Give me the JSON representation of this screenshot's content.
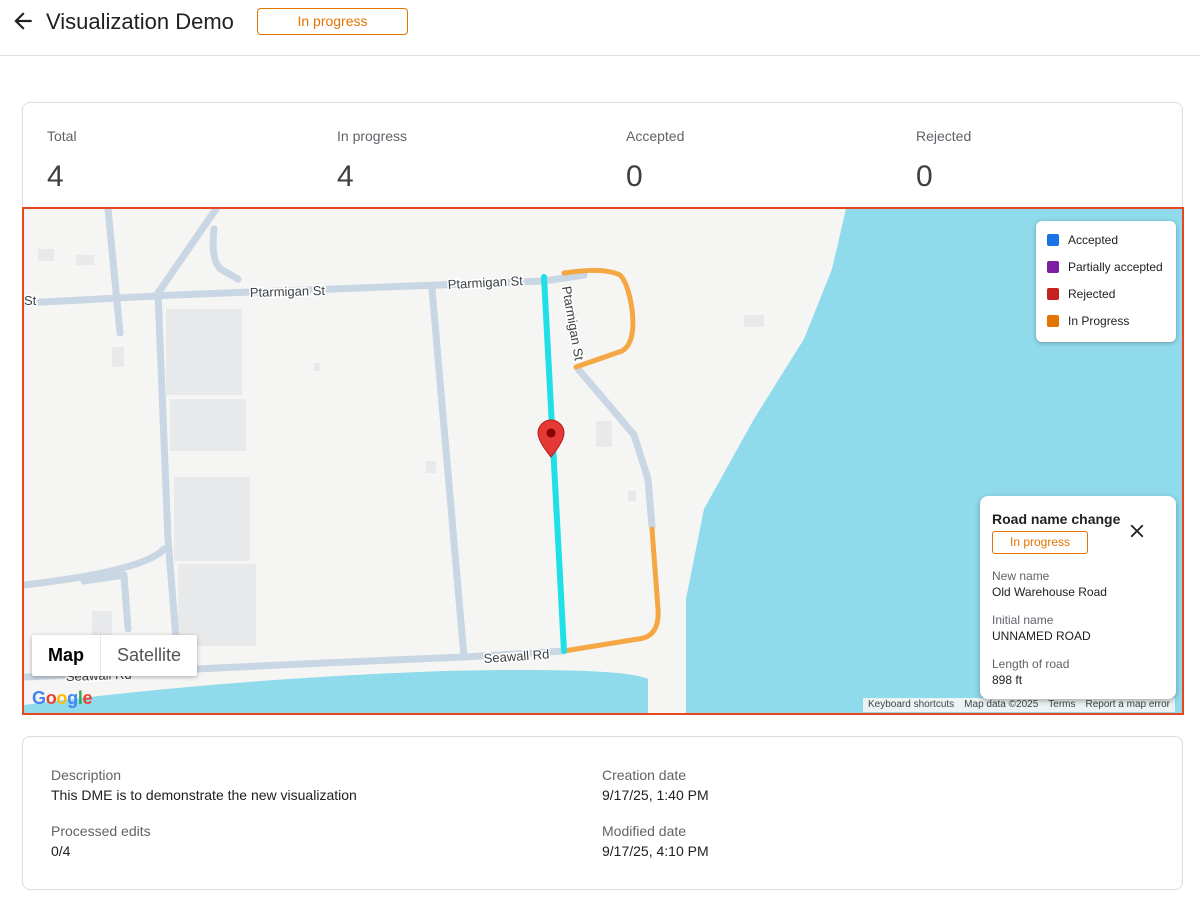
{
  "header": {
    "title": "Visualization Demo",
    "status": "In progress",
    "back_icon": "arrow-left-icon"
  },
  "stats": [
    {
      "label": "Total",
      "value": "4"
    },
    {
      "label": "In progress",
      "value": "4"
    },
    {
      "label": "Accepted",
      "value": "0"
    },
    {
      "label": "Rejected",
      "value": "0"
    }
  ],
  "map": {
    "streets": {
      "ptarmigan_main": "Ptarmigan St",
      "ptarmigan_east": "Ptarmigan St",
      "ptarmigan_vertical": "Ptarmigan St",
      "ptarmigan_left_edge": "St",
      "seawall": "Seawall Rd",
      "seawall_west": "Seawall Rd"
    },
    "legend": [
      {
        "label": "Accepted",
        "color": "#1a73e8"
      },
      {
        "label": "Partially accepted",
        "color": "#7b1fa2"
      },
      {
        "label": "Rejected",
        "color": "#c5221f"
      },
      {
        "label": "In Progress",
        "color": "#e37400"
      }
    ],
    "map_type": {
      "map": "Map",
      "satellite": "Satellite",
      "selected": "Map"
    },
    "google_logo": "Google",
    "attribution": {
      "shortcuts": "Keyboard shortcuts",
      "data": "Map data ©2025",
      "terms": "Terms",
      "report": "Report a map error"
    },
    "colors": {
      "water": "#8fdaeb",
      "road": "#c9d6e3",
      "selected_road": "#1fe0e6",
      "in_progress_road": "#f4a742",
      "marker": "#e53935"
    },
    "info_card": {
      "title": "Road name change",
      "status": "In progress",
      "new_name_label": "New name",
      "new_name": "Old Warehouse Road",
      "initial_name_label": "Initial name",
      "initial_name": "UNNAMED ROAD",
      "length_label": "Length of road",
      "length": "898 ft"
    }
  },
  "details": {
    "description_label": "Description",
    "description": "This DME is to demonstrate the new visualization",
    "processed_label": "Processed edits",
    "processed": "0/4",
    "creation_label": "Creation date",
    "creation": "9/17/25, 1:40 PM",
    "modified_label": "Modified date",
    "modified": "9/17/25, 4:10 PM"
  }
}
